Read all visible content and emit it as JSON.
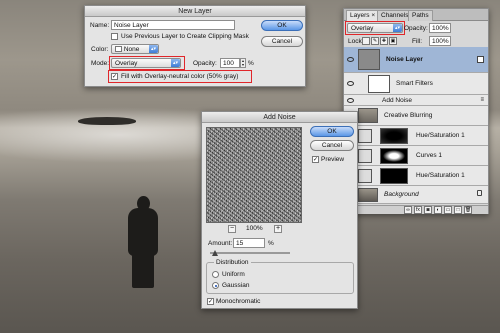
{
  "new_layer": {
    "title": "New Layer",
    "name_label": "Name:",
    "name_value": "Noise Layer",
    "clipping_mask_label": "Use Previous Layer to Create Clipping Mask",
    "color_label": "Color:",
    "color_value": "None",
    "mode_label": "Mode:",
    "mode_value": "Overlay",
    "opacity_label": "Opacity:",
    "opacity_value": "100",
    "opacity_unit": "%",
    "fill_label": "Fill with Overlay-neutral color (50% gray)",
    "ok_label": "OK",
    "cancel_label": "Cancel"
  },
  "layers_panel": {
    "tabs": [
      "Layers",
      "Channels",
      "Paths"
    ],
    "blend_mode": "Overlay",
    "opacity_label": "Opacity:",
    "opacity_value": "100%",
    "lock_label": "Lock:",
    "fill_label": "Fill:",
    "fill_value": "100%",
    "layers": [
      {
        "name": "Noise Layer"
      },
      {
        "name": "Smart Filters"
      },
      {
        "name": "Add Noise"
      },
      {
        "name": "Creative Blurring"
      },
      {
        "name": "Hue/Saturation 1"
      },
      {
        "name": "Curves 1"
      },
      {
        "name": "Hue/Saturation 1"
      },
      {
        "name": "Background"
      }
    ]
  },
  "add_noise": {
    "title": "Add Noise",
    "ok_label": "OK",
    "cancel_label": "Cancel",
    "preview_label": "Preview",
    "zoom_value": "100%",
    "zoom_out": "−",
    "zoom_in": "+",
    "amount_label": "Amount:",
    "amount_value": "15",
    "amount_unit": "%",
    "distribution_label": "Distribution",
    "uniform_label": "Uniform",
    "gaussian_label": "Gaussian",
    "mono_label": "Monochromatic"
  },
  "colors": {
    "highlight_red": "#e0262a",
    "button_blue": "#5b97e6"
  }
}
